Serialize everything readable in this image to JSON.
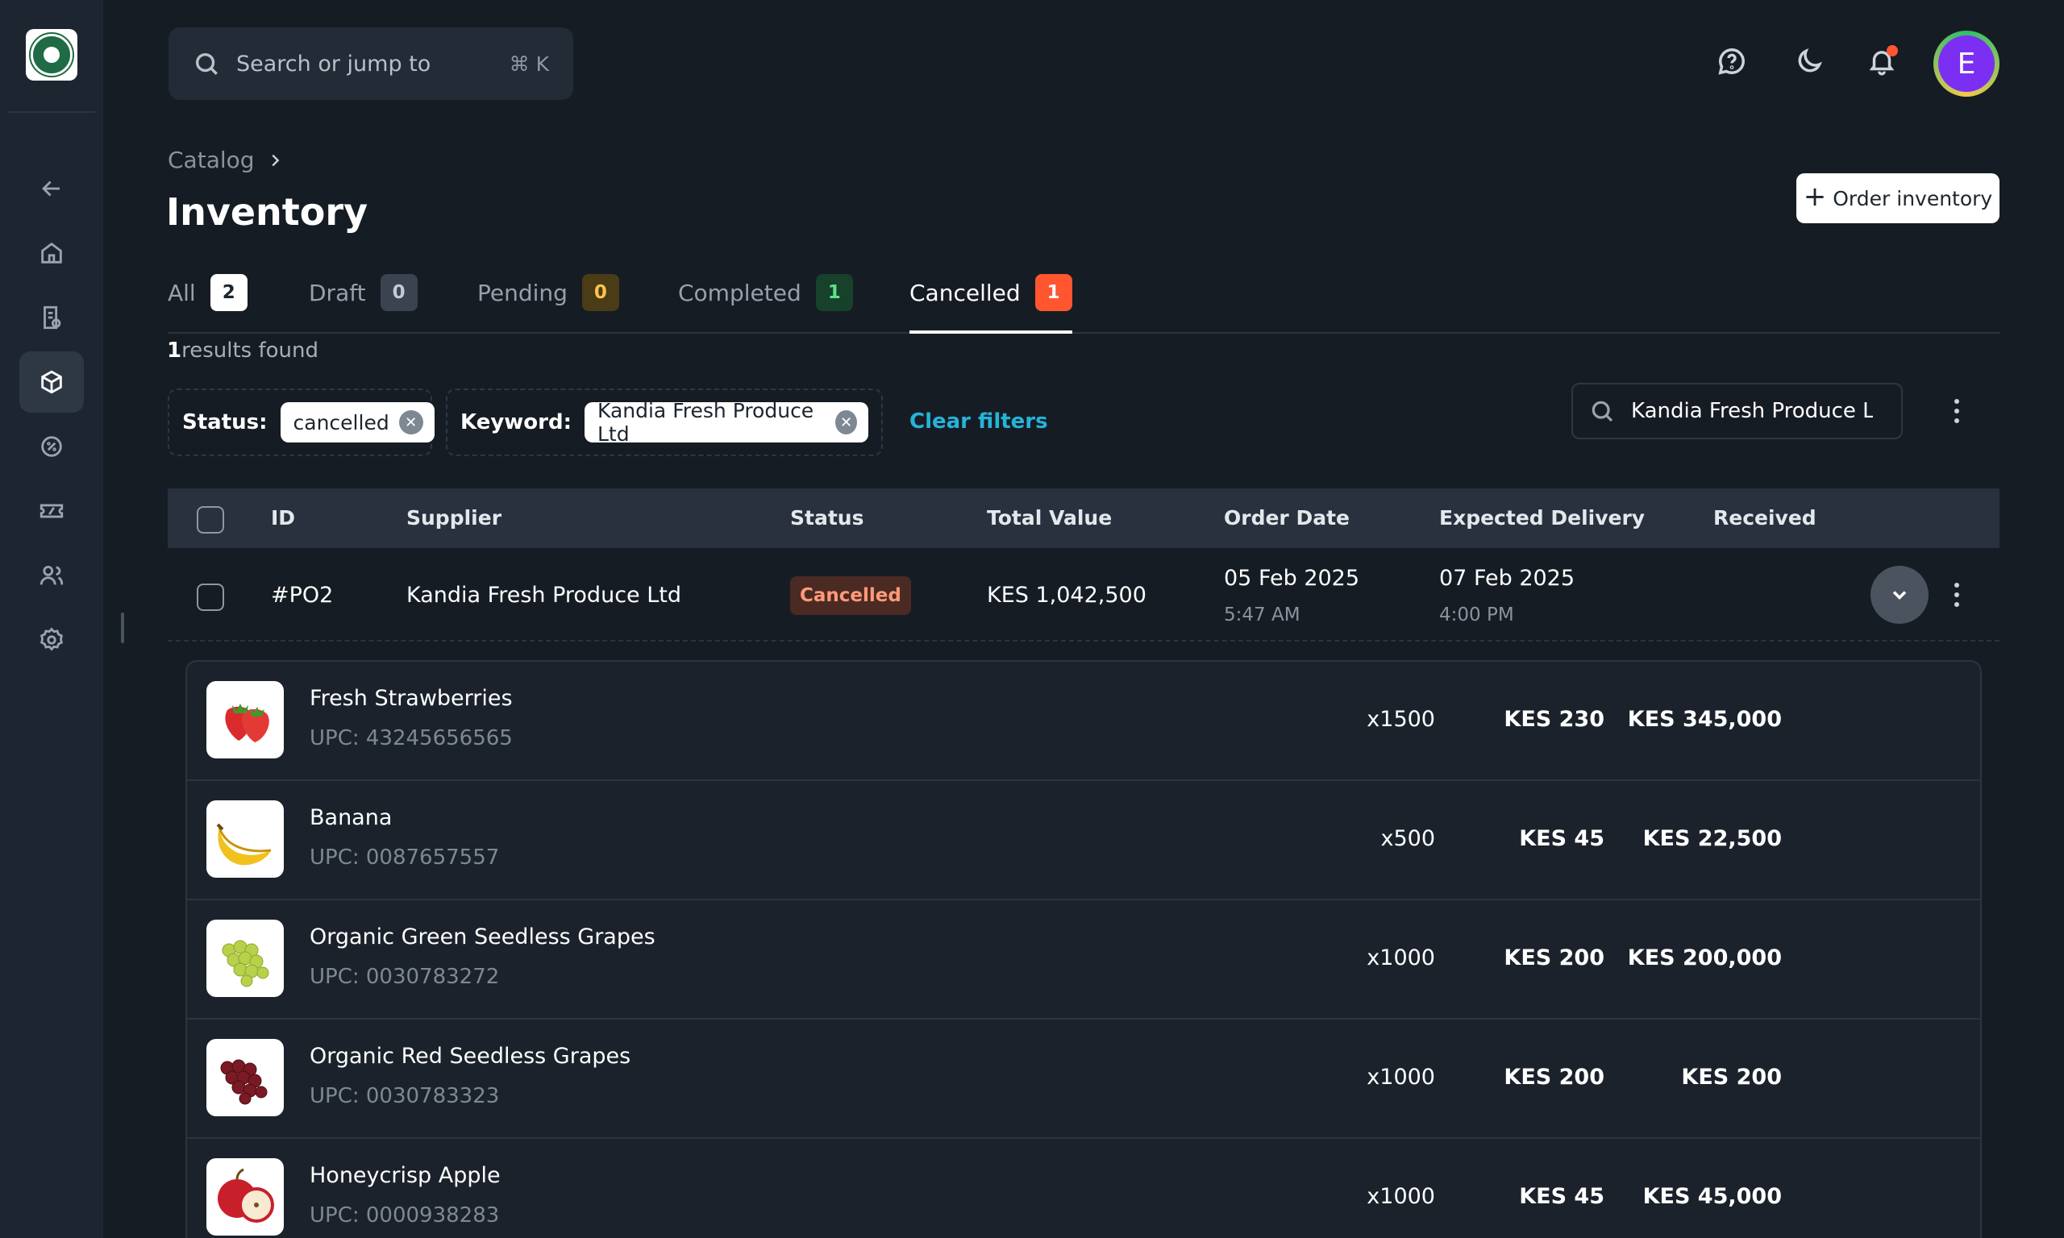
{
  "header": {
    "search_placeholder": "Search or jump to",
    "search_shortcut": "⌘ K",
    "avatar_initial": "E"
  },
  "sidebar": {
    "items": [
      {
        "icon": "arrow-left-icon"
      },
      {
        "icon": "home-icon"
      },
      {
        "icon": "orders-icon"
      },
      {
        "icon": "box-icon",
        "active": true
      },
      {
        "icon": "discount-icon"
      },
      {
        "icon": "ticket-icon"
      },
      {
        "icon": "users-icon"
      },
      {
        "icon": "gear-icon"
      }
    ]
  },
  "page": {
    "breadcrumb": "Catalog",
    "title": "Inventory",
    "order_button": "Order inventory"
  },
  "tabs": [
    {
      "label": "All",
      "count": "2"
    },
    {
      "label": "Draft",
      "count": "0"
    },
    {
      "label": "Pending",
      "count": "0"
    },
    {
      "label": "Completed",
      "count": "1"
    },
    {
      "label": "Cancelled",
      "count": "1",
      "active": true
    }
  ],
  "results": {
    "count": "1",
    "label": "results found"
  },
  "filters": {
    "status_key": "Status:",
    "status_value": "cancelled",
    "keyword_key": "Keyword:",
    "keyword_value": "Kandia Fresh Produce Ltd",
    "clear_label": "Clear filters",
    "search_value": "Kandia Fresh Produce Ltd"
  },
  "table": {
    "columns": [
      "ID",
      "Supplier",
      "Status",
      "Total Value",
      "Order Date",
      "Expected Delivery",
      "Received"
    ],
    "rows": [
      {
        "id": "#PO2",
        "supplier": "Kandia Fresh Produce Ltd",
        "status": "Cancelled",
        "total": "KES 1,042,500",
        "order_date": "05 Feb 2025",
        "order_time": "5:47 AM",
        "delivery_date": "07 Feb 2025",
        "delivery_time": "4:00 PM"
      }
    ]
  },
  "items": [
    {
      "name": "Fresh Strawberries",
      "upc": "UPC: 43245656565",
      "qty": "x1500",
      "price": "KES 230",
      "total": "KES 345,000",
      "thumb": "strawberry"
    },
    {
      "name": "Banana",
      "upc": "UPC: 0087657557",
      "qty": "x500",
      "price": "KES 45",
      "total": "KES 22,500",
      "thumb": "banana"
    },
    {
      "name": "Organic Green Seedless Grapes",
      "upc": "UPC: 0030783272",
      "qty": "x1000",
      "price": "KES 200",
      "total": "KES 200,000",
      "thumb": "green-grapes"
    },
    {
      "name": "Organic Red Seedless Grapes",
      "upc": "UPC: 0030783323",
      "qty": "x1000",
      "price": "KES 200",
      "total": "KES 200",
      "thumb": "red-grapes"
    },
    {
      "name": "Honeycrisp Apple",
      "upc": "UPC: 0000938283",
      "qty": "x1000",
      "price": "KES 45",
      "total": "KES 45,000",
      "thumb": "apple"
    }
  ]
}
